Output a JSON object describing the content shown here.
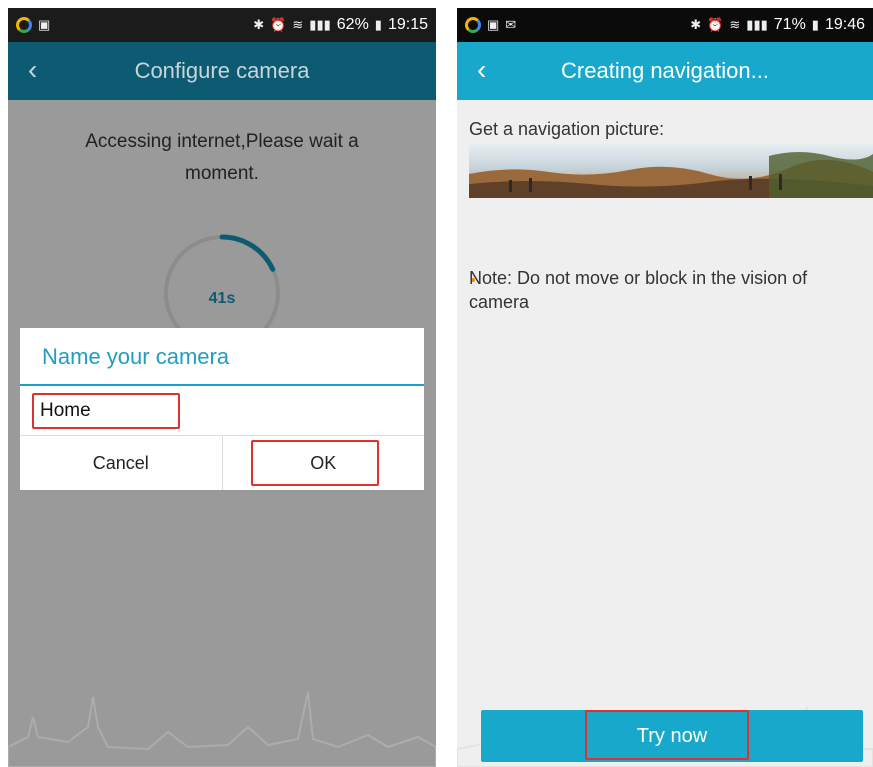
{
  "left": {
    "status": {
      "battery": "62%",
      "time": "19:15"
    },
    "appbar": {
      "title": "Configure camera"
    },
    "wait_text": "Accessing internet,Please wait a moment.",
    "timer": "41s",
    "progress_fraction": 0.18,
    "dialog": {
      "title": "Name your camera",
      "input_value": "Home",
      "cancel_label": "Cancel",
      "ok_label": "OK"
    }
  },
  "right": {
    "status": {
      "battery": "71%",
      "time": "19:46"
    },
    "appbar": {
      "title": "Creating navigation..."
    },
    "nav_label": "Get a navigation picture:",
    "note": "Note: Do not move or block in the vision of camera",
    "button_label": "Try now"
  },
  "colors": {
    "accent": "#17a8cc",
    "dark_accent": "#0d5b72",
    "highlight": "#e03131"
  }
}
